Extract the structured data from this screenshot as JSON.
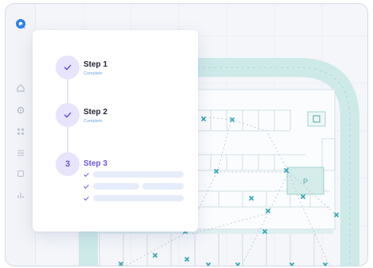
{
  "sidebar": {
    "logo": "logo-icon",
    "icons": [
      "home-icon",
      "settings-icon",
      "grid-icon",
      "list-icon",
      "box-icon",
      "chart-icon"
    ]
  },
  "map": {
    "parking_label": "P",
    "sign_icon": "sign-icon",
    "marker_icon": "x-marker-icon"
  },
  "wizard": {
    "steps": [
      {
        "number": "1",
        "title": "Step 1",
        "status": "Complete",
        "state": "done"
      },
      {
        "number": "2",
        "title": "Step 2",
        "status": "Complete",
        "state": "done"
      },
      {
        "number": "3",
        "title": "Step 3",
        "status": "",
        "state": "active"
      }
    ],
    "subtasks_checked": 3
  },
  "colors": {
    "accent": "#6b56e0",
    "accent_soft": "#e8e4fb",
    "link": "#6aa8d8",
    "map_road": "#cdeae9",
    "map_marker": "#37a9b9"
  }
}
